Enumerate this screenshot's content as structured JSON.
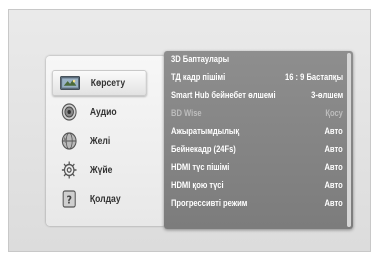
{
  "nav": {
    "items": [
      {
        "label": "Көрсету",
        "icon": "display-icon",
        "selected": true
      },
      {
        "label": "Аудио",
        "icon": "speaker-icon",
        "selected": false
      },
      {
        "label": "Желі",
        "icon": "globe-icon",
        "selected": false
      },
      {
        "label": "Жүйе",
        "icon": "gear-icon",
        "selected": false
      },
      {
        "label": "Қолдау",
        "icon": "help-icon",
        "selected": false
      }
    ]
  },
  "menu": {
    "rows": [
      {
        "label": "3D Баптаулары",
        "value": "",
        "disabled": false
      },
      {
        "label": "ТД кадр пішімі",
        "value": "16 : 9 Бастапқы",
        "disabled": false
      },
      {
        "label": "Smart Hub бейнебет өлшемі",
        "value": "3-өлшем",
        "disabled": false
      },
      {
        "label": "BD Wise",
        "value": "Қосу",
        "disabled": true
      },
      {
        "label": "Ажыратымдылық",
        "value": "Авто",
        "disabled": false
      },
      {
        "label": "Бейнекадр (24Fs)",
        "value": "Авто",
        "disabled": false
      },
      {
        "label": "HDMI түс пішімі",
        "value": "Авто",
        "disabled": false
      },
      {
        "label": "HDMI қою түсі",
        "value": "Авто",
        "disabled": false
      },
      {
        "label": "Прогрессивті режим",
        "value": "Авто",
        "disabled": false
      }
    ]
  },
  "colors": {
    "panel": "#858585",
    "text": "#ffffff",
    "disabled_text": "#bdbdbd"
  }
}
